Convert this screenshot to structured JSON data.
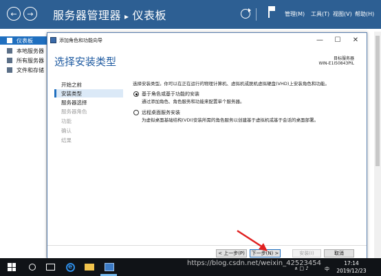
{
  "server_manager": {
    "title": "服务器管理器",
    "section": "仪表板",
    "menu": {
      "manage": "管理(M)",
      "tools": "工具(T)",
      "view": "视图(V)",
      "help": "帮助(H)"
    },
    "nav_back_glyph": "←",
    "nav_forward_glyph": "→",
    "sep_glyph": "▸"
  },
  "left_nav": [
    {
      "label": "仪表板",
      "active": true
    },
    {
      "label": "本地服务器"
    },
    {
      "label": "所有服务器"
    },
    {
      "label": "文件和存储"
    }
  ],
  "wizard": {
    "window_title": "添加角色和功能向导",
    "min_glyph": "—",
    "max_glyph": "☐",
    "close_glyph": "✕",
    "heading": "选择安装类型",
    "target_label": "目标服务器",
    "target_value": "WIN-E1I50843PIL",
    "steps": [
      {
        "label": "开始之前",
        "state": "normal"
      },
      {
        "label": "安装类型",
        "state": "current"
      },
      {
        "label": "服务器选择",
        "state": "normal"
      },
      {
        "label": "服务器角色",
        "state": "disabled"
      },
      {
        "label": "功能",
        "state": "disabled"
      },
      {
        "label": "确认",
        "state": "disabled"
      },
      {
        "label": "结果",
        "state": "disabled"
      }
    ],
    "description": "选择安装类型。你可以在正在运行的物理计算机、虚拟机或脱机虚拟硬盘(VHD)上安装角色和功能。",
    "options": [
      {
        "label": "基于角色或基于功能的安装",
        "desc": "通过添加角色、角色服务和功能来配置单个服务器。",
        "selected": true
      },
      {
        "label": "远程桌面服务安装",
        "desc": "为虚拟桌面基础结构(VDI)安装所需的角色服务以创建基于虚拟机或基于会话的桌面部署。",
        "selected": false
      }
    ],
    "buttons": {
      "prev": "< 上一步(P)",
      "next": "下一步(N) >",
      "install": "安装(I)",
      "cancel": "取消"
    }
  },
  "taskbar": {
    "ie_glyph": "e",
    "tray_text": "∧  □  ♪",
    "lang": "中",
    "time": "17:14",
    "date": "2019/12/23"
  },
  "watermark": "https://blog.csdn.net/weixin_42523454"
}
